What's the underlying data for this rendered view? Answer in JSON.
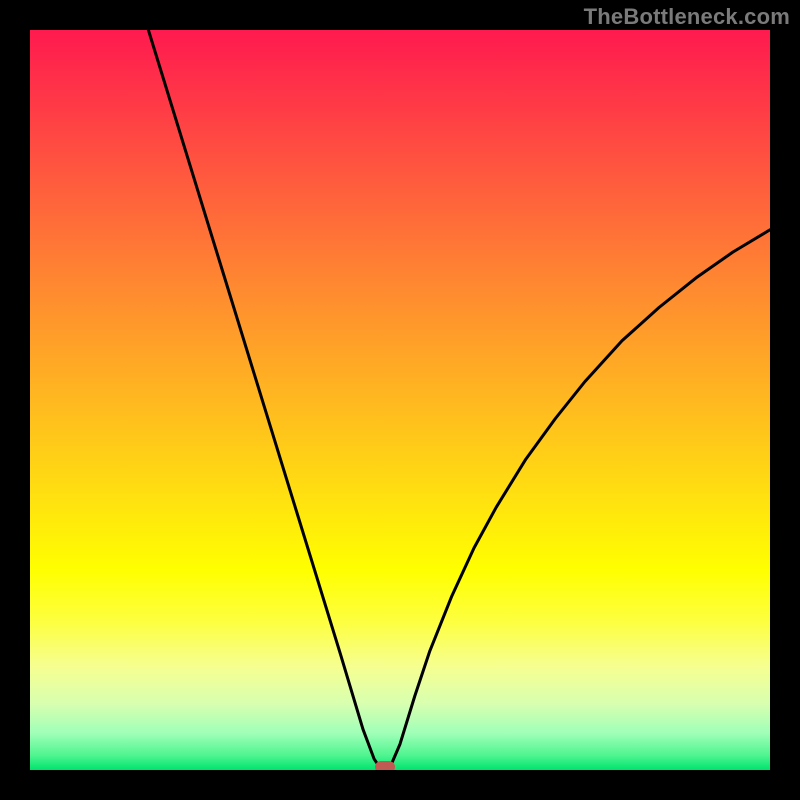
{
  "watermark": "TheBottleneck.com",
  "colors": {
    "frame": "#000000",
    "curve": "#000000",
    "marker": "#c15a52"
  },
  "chart_data": {
    "type": "line",
    "title": "",
    "xlabel": "",
    "ylabel": "",
    "xlim": [
      0,
      100
    ],
    "ylim": [
      0,
      100
    ],
    "grid": false,
    "legend": false,
    "series": [
      {
        "name": "bottleneck-curve",
        "x": [
          16,
          18,
          20,
          22,
          24,
          26,
          28,
          30,
          32,
          34,
          36,
          38,
          40,
          42,
          43.5,
          45,
          46.5,
          47.5,
          48.5,
          50,
          52,
          54,
          57,
          60,
          63,
          67,
          71,
          75,
          80,
          85,
          90,
          95,
          100
        ],
        "y": [
          100,
          93.5,
          87,
          80.5,
          74,
          67.5,
          61,
          54.5,
          48,
          41.5,
          35,
          28.5,
          22,
          15.5,
          10.5,
          5.5,
          1.5,
          0,
          0,
          3.5,
          10,
          16,
          23.5,
          30,
          35.5,
          42,
          47.5,
          52.5,
          58,
          62.5,
          66.5,
          70,
          73
        ]
      }
    ],
    "marker": {
      "x": 48,
      "y": 0
    },
    "background_gradient_stops": [
      {
        "pos": 0,
        "color": "#ff1a4f"
      },
      {
        "pos": 73,
        "color": "#ffff00"
      },
      {
        "pos": 100,
        "color": "#00e36e"
      }
    ]
  }
}
